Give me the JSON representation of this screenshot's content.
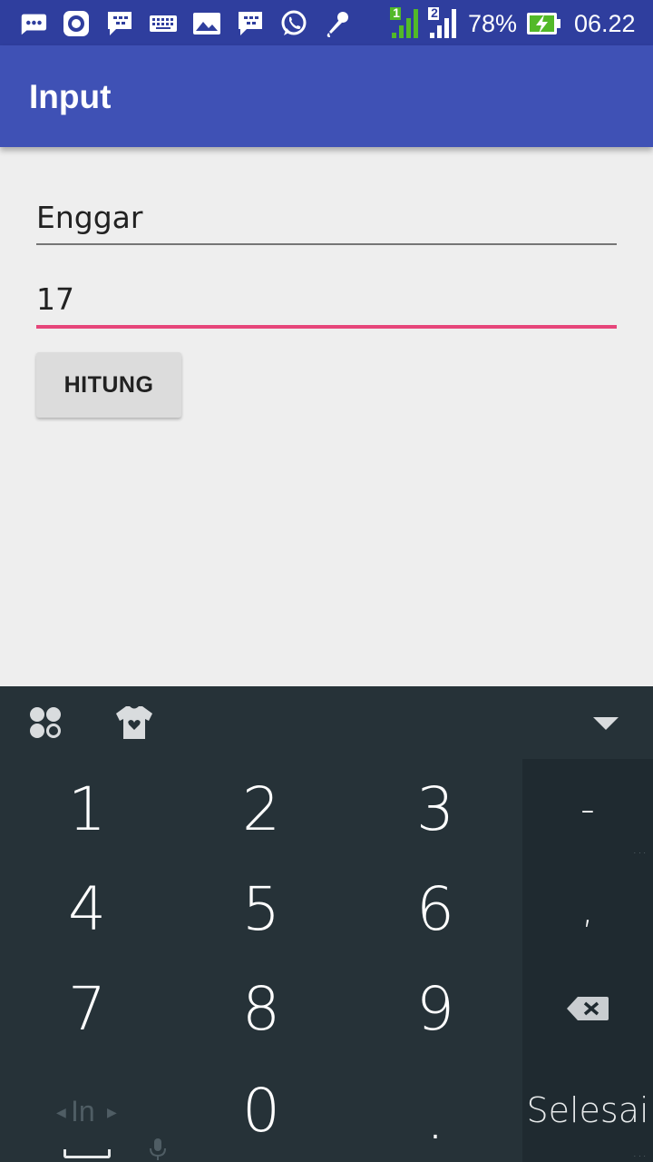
{
  "status_bar": {
    "icons": [
      "chat-bubble-icon",
      "record-icon",
      "bbm-icon",
      "keyboard-icon",
      "gallery-icon",
      "bbm-icon",
      "whatsapp-icon",
      "microphone-icon"
    ],
    "sim1_label": "1",
    "sim2_label": "2",
    "battery": "78%",
    "time": "06.22"
  },
  "appbar": {
    "title": "Input"
  },
  "form": {
    "name_value": "Enggar",
    "age_value": "17",
    "button_label": "HITUNG"
  },
  "keyboard": {
    "keys": [
      [
        "1",
        "2",
        "3"
      ],
      [
        "4",
        "5",
        "6"
      ],
      [
        "7",
        "8",
        "9"
      ],
      [
        "0",
        "."
      ]
    ],
    "side_keys": {
      "minus": "-",
      "comma": ",",
      "done": "Selesai"
    },
    "language": "In",
    "colors": {
      "background": "#263238",
      "side": "#1f2a30",
      "key_text": "#ffffff"
    }
  },
  "colors": {
    "status_bar": "#2f3e9e",
    "app_bar": "#3f51b5",
    "accent": "#e6457a",
    "page": "#eeeeee"
  }
}
